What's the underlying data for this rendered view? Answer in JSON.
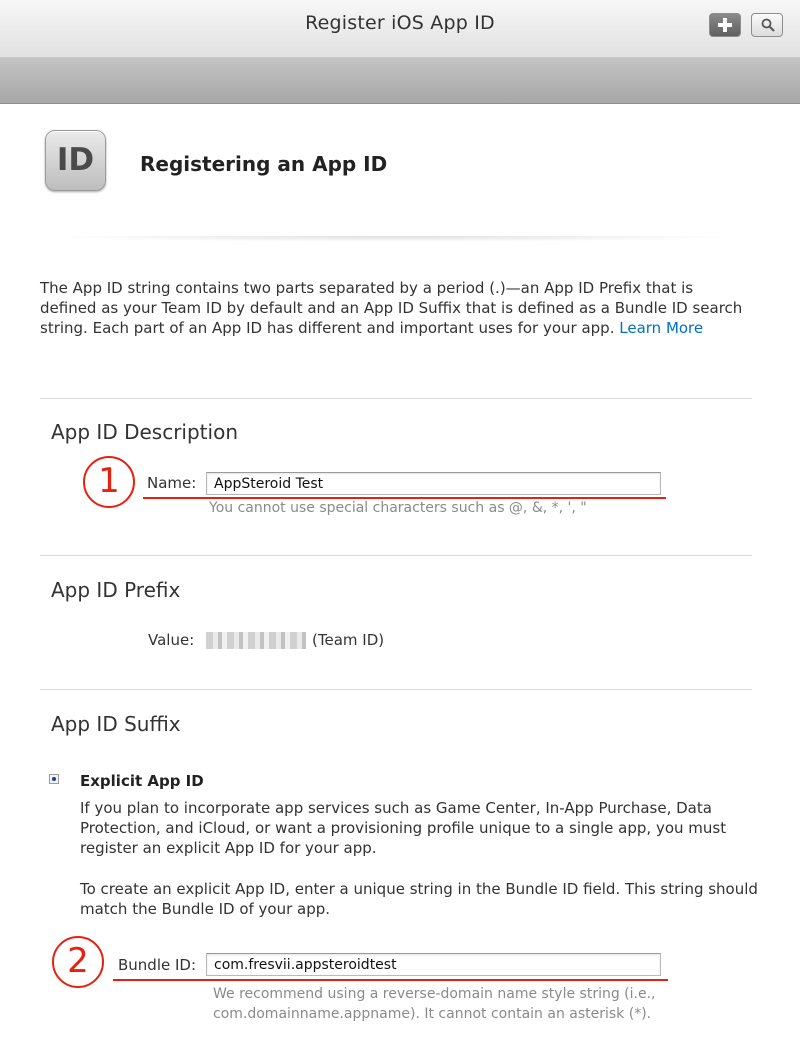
{
  "window": {
    "title": "Register iOS App ID",
    "add_icon": "plus-icon",
    "search_icon": "search-icon"
  },
  "header": {
    "icon_text": "ID",
    "title": "Registering an App ID"
  },
  "intro": {
    "text": "The App ID string contains two parts separated by a period (.)—an App ID Prefix that is defined as your Team ID by default and an App ID Suffix that is defined as a Bundle ID search string. Each part of an App ID has different and important uses for your app. ",
    "learn_more": "Learn More"
  },
  "description_section": {
    "title": "App ID Description",
    "annotation_number": "1",
    "name_label": "Name:",
    "name_value": "AppSteroid Test",
    "hint": "You cannot use special characters such as @, &, *, ', \""
  },
  "prefix_section": {
    "title": "App ID Prefix",
    "value_label": "Value:",
    "team_suffix": "(Team ID)"
  },
  "suffix_section": {
    "title": "App ID Suffix",
    "option_title": "Explicit App ID",
    "option_selected": true,
    "paragraph_1": "If you plan to incorporate app services such as Game Center, In-App Purchase, Data Protection, and iCloud, or want a provisioning profile unique to a single app, you must register an explicit App ID for your app.",
    "paragraph_2": "To create an explicit App ID, enter a unique string in the Bundle ID field. This string should match the Bundle ID of your app.",
    "annotation_number": "2",
    "bundle_label": "Bundle ID:",
    "bundle_value": "com.fresvii.appsteroidtest",
    "hint_line1": "We recommend using a reverse-domain name style string (i.e.,",
    "hint_line2": "com.domainname.appname). It cannot contain an asterisk (*)."
  },
  "colors": {
    "annotation": "#e8200f",
    "link": "#0070c9"
  }
}
